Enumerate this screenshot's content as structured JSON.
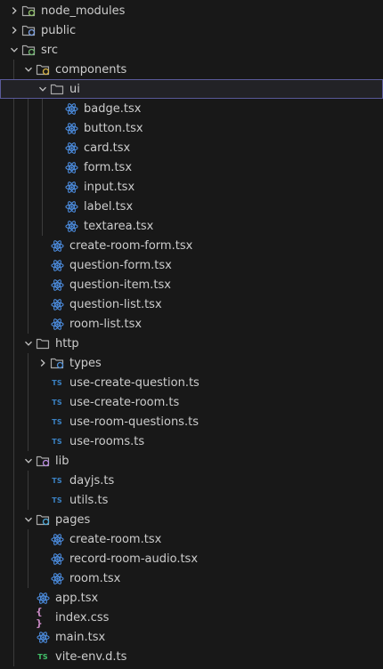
{
  "explorer": {
    "rows": [
      {
        "label": "node_modules",
        "depth": 0,
        "kind": "folder",
        "expanded": false,
        "icon": "folder-node-icon"
      },
      {
        "label": "public",
        "depth": 0,
        "kind": "folder",
        "expanded": false,
        "icon": "folder-public-icon"
      },
      {
        "label": "src",
        "depth": 0,
        "kind": "folder",
        "expanded": true,
        "icon": "folder-src-icon"
      },
      {
        "label": "components",
        "depth": 1,
        "kind": "folder",
        "expanded": true,
        "icon": "folder-components-icon"
      },
      {
        "label": "ui",
        "depth": 2,
        "kind": "folder",
        "expanded": true,
        "icon": "folder-icon",
        "selected": true
      },
      {
        "label": "badge.tsx",
        "depth": 3,
        "kind": "file",
        "icon": "react-icon"
      },
      {
        "label": "button.tsx",
        "depth": 3,
        "kind": "file",
        "icon": "react-icon"
      },
      {
        "label": "card.tsx",
        "depth": 3,
        "kind": "file",
        "icon": "react-icon"
      },
      {
        "label": "form.tsx",
        "depth": 3,
        "kind": "file",
        "icon": "react-icon"
      },
      {
        "label": "input.tsx",
        "depth": 3,
        "kind": "file",
        "icon": "react-icon"
      },
      {
        "label": "label.tsx",
        "depth": 3,
        "kind": "file",
        "icon": "react-icon"
      },
      {
        "label": "textarea.tsx",
        "depth": 3,
        "kind": "file",
        "icon": "react-icon"
      },
      {
        "label": "create-room-form.tsx",
        "depth": 2,
        "kind": "file",
        "icon": "react-icon"
      },
      {
        "label": "question-form.tsx",
        "depth": 2,
        "kind": "file",
        "icon": "react-icon"
      },
      {
        "label": "question-item.tsx",
        "depth": 2,
        "kind": "file",
        "icon": "react-icon"
      },
      {
        "label": "question-list.tsx",
        "depth": 2,
        "kind": "file",
        "icon": "react-icon"
      },
      {
        "label": "room-list.tsx",
        "depth": 2,
        "kind": "file",
        "icon": "react-icon"
      },
      {
        "label": "http",
        "depth": 1,
        "kind": "folder",
        "expanded": true,
        "icon": "folder-icon"
      },
      {
        "label": "types",
        "depth": 2,
        "kind": "folder",
        "expanded": false,
        "icon": "folder-types-icon"
      },
      {
        "label": "use-create-question.ts",
        "depth": 2,
        "kind": "file",
        "icon": "typescript-icon",
        "badge": "TS"
      },
      {
        "label": "use-create-room.ts",
        "depth": 2,
        "kind": "file",
        "icon": "typescript-icon",
        "badge": "TS"
      },
      {
        "label": "use-room-questions.ts",
        "depth": 2,
        "kind": "file",
        "icon": "typescript-icon",
        "badge": "TS"
      },
      {
        "label": "use-rooms.ts",
        "depth": 2,
        "kind": "file",
        "icon": "typescript-icon",
        "badge": "TS"
      },
      {
        "label": "lib",
        "depth": 1,
        "kind": "folder",
        "expanded": true,
        "icon": "folder-lib-icon"
      },
      {
        "label": "dayjs.ts",
        "depth": 2,
        "kind": "file",
        "icon": "typescript-icon",
        "badge": "TS"
      },
      {
        "label": "utils.ts",
        "depth": 2,
        "kind": "file",
        "icon": "typescript-icon",
        "badge": "TS"
      },
      {
        "label": "pages",
        "depth": 1,
        "kind": "folder",
        "expanded": true,
        "icon": "folder-pages-icon"
      },
      {
        "label": "create-room.tsx",
        "depth": 2,
        "kind": "file",
        "icon": "react-icon"
      },
      {
        "label": "record-room-audio.tsx",
        "depth": 2,
        "kind": "file",
        "icon": "react-icon"
      },
      {
        "label": "room.tsx",
        "depth": 2,
        "kind": "file",
        "icon": "react-icon"
      },
      {
        "label": "app.tsx",
        "depth": 1,
        "kind": "file",
        "icon": "react-icon"
      },
      {
        "label": "index.css",
        "depth": 1,
        "kind": "file",
        "icon": "css-icon",
        "badge": "{ }"
      },
      {
        "label": "main.tsx",
        "depth": 1,
        "kind": "file",
        "icon": "react-icon"
      },
      {
        "label": "vite-env.d.ts",
        "depth": 1,
        "kind": "file",
        "icon": "typescript-def-icon",
        "badge": "TS"
      }
    ]
  },
  "colors": {
    "background": "#181818",
    "text": "#cccccc",
    "selection_border": "#5a5a9a",
    "react": "#4d8fe3",
    "typescript": "#3b82c4",
    "typescript_def": "#42c26a",
    "css": "#c586c0"
  }
}
